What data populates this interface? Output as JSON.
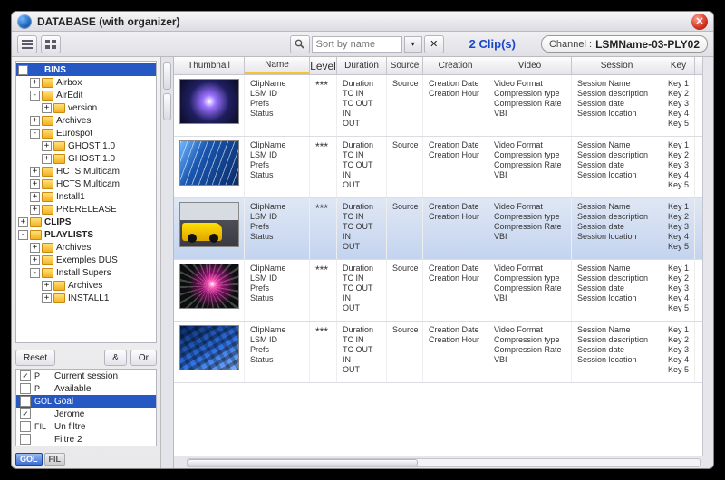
{
  "title": "DATABASE (with organizer)",
  "toolbar": {
    "sort_placeholder": "Sort by name",
    "clip_count": "2 Clip(s)",
    "channel_label": "Channel :",
    "channel_value": "LSMName-03-PLY02"
  },
  "tree": [
    {
      "d": 1,
      "exp": "-",
      "folder": "sel",
      "label": "BINS",
      "bold": true,
      "sel": true
    },
    {
      "d": 2,
      "exp": "+",
      "folder": "y",
      "label": "Airbox"
    },
    {
      "d": 2,
      "exp": "-",
      "folder": "y",
      "label": "AirEdit"
    },
    {
      "d": 3,
      "exp": "+",
      "folder": "y",
      "label": "version"
    },
    {
      "d": 2,
      "exp": "+",
      "folder": "y",
      "label": "Archives"
    },
    {
      "d": 2,
      "exp": "-",
      "folder": "y",
      "label": "Eurospot"
    },
    {
      "d": 3,
      "exp": "+",
      "folder": "y",
      "label": "GHOST 1.0"
    },
    {
      "d": 3,
      "exp": "+",
      "folder": "y",
      "label": "GHOST 1.0"
    },
    {
      "d": 2,
      "exp": "+",
      "folder": "y",
      "label": "HCTS Multicam"
    },
    {
      "d": 2,
      "exp": "+",
      "folder": "y",
      "label": "HCTS Multicam"
    },
    {
      "d": 2,
      "exp": "+",
      "folder": "y",
      "label": "Install1"
    },
    {
      "d": 2,
      "exp": "+",
      "folder": "y",
      "label": "PRERELEASE"
    },
    {
      "d": 1,
      "exp": "+",
      "folder": "y",
      "label": "CLIPS",
      "bold": true
    },
    {
      "d": 1,
      "exp": "-",
      "folder": "y",
      "label": "PLAYLISTS",
      "bold": true
    },
    {
      "d": 2,
      "exp": "+",
      "folder": "y",
      "label": "Archives"
    },
    {
      "d": 2,
      "exp": "+",
      "folder": "y",
      "label": "Exemples DUS"
    },
    {
      "d": 2,
      "exp": "-",
      "folder": "y",
      "label": "Install Supers"
    },
    {
      "d": 3,
      "exp": "+",
      "folder": "y",
      "label": "Archives"
    },
    {
      "d": 3,
      "exp": "+",
      "folder": "y",
      "label": "INSTALL1"
    }
  ],
  "reset": {
    "reset": "Reset",
    "and": "&",
    "or": "Or"
  },
  "filters": [
    {
      "chk": true,
      "tag": "P",
      "name": "Current session"
    },
    {
      "chk": false,
      "tag": "P",
      "name": "Available"
    },
    {
      "chk": false,
      "tag": "GOL",
      "name": "Goal",
      "sel": true
    },
    {
      "chk": true,
      "tag": "",
      "name": "Jerome"
    },
    {
      "chk": false,
      "tag": "FIL",
      "name": "Un filtre"
    },
    {
      "chk": false,
      "tag": "",
      "name": "Filtre 2"
    }
  ],
  "pills": {
    "gol": "GOL",
    "fil": "FIL"
  },
  "columns": [
    "Thumbnail",
    "Name",
    "Level",
    "Duration",
    "Source",
    "Creation",
    "Video",
    "Session",
    "Key"
  ],
  "cellvals": {
    "name": [
      "ClipName",
      "LSM ID",
      "Prefs",
      "Status"
    ],
    "level": "***",
    "duration": [
      "Duration",
      "TC IN",
      "TC OUT",
      "IN",
      "OUT"
    ],
    "source": "Source",
    "creation": [
      "Creation Date",
      "Creation Hour"
    ],
    "video": [
      "Video Format",
      "Compression type",
      "Compression Rate",
      "VBI"
    ],
    "session": [
      "Session Name",
      "Session description",
      "Session date",
      "Session location"
    ],
    "key": [
      "Key 1",
      "Key 2",
      "Key 3",
      "Key 4",
      "Key 5"
    ]
  },
  "rows": [
    {
      "thumb": "t1"
    },
    {
      "thumb": "t2"
    },
    {
      "thumb": "t3",
      "sel": true
    },
    {
      "thumb": "t4"
    },
    {
      "thumb": "t5"
    }
  ]
}
